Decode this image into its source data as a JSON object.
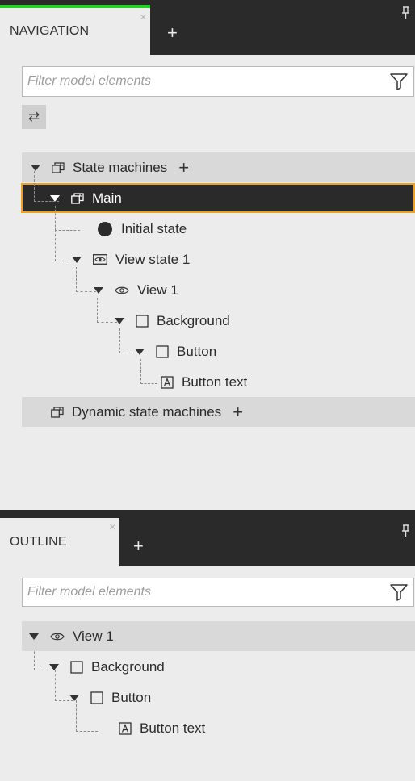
{
  "navigation": {
    "tab_label": "NAVIGATION",
    "tab_close": "×",
    "tab_add": "+",
    "filter_placeholder": "Filter model elements",
    "swap_icon": "⇄",
    "tree": {
      "state_machines": "State machines",
      "main": "Main",
      "initial_state": "Initial state",
      "view_state_1": "View state 1",
      "view_1": "View 1",
      "background": "Background",
      "button": "Button",
      "button_text": "Button text",
      "dynamic_state_machines": "Dynamic state machines",
      "add": "+"
    }
  },
  "outline": {
    "tab_label": "OUTLINE",
    "tab_close": "×",
    "tab_add": "+",
    "filter_placeholder": "Filter model elements",
    "tree": {
      "view_1": "View 1",
      "background": "Background",
      "button": "Button",
      "button_text": "Button text"
    }
  },
  "colors": {
    "accent_tab": "#1fd51f",
    "selection_border": "#f0a020",
    "panel_bg": "#ececec",
    "dark_bar": "#2a2a2a"
  },
  "icons": {
    "pin": "pin-icon",
    "filter": "funnel-icon",
    "state_machine": "state-machine-icon",
    "initial_state": "filled-circle-icon",
    "view_state": "view-state-icon",
    "view": "eye-icon",
    "rectangle": "square-icon",
    "text": "text-box-icon"
  }
}
